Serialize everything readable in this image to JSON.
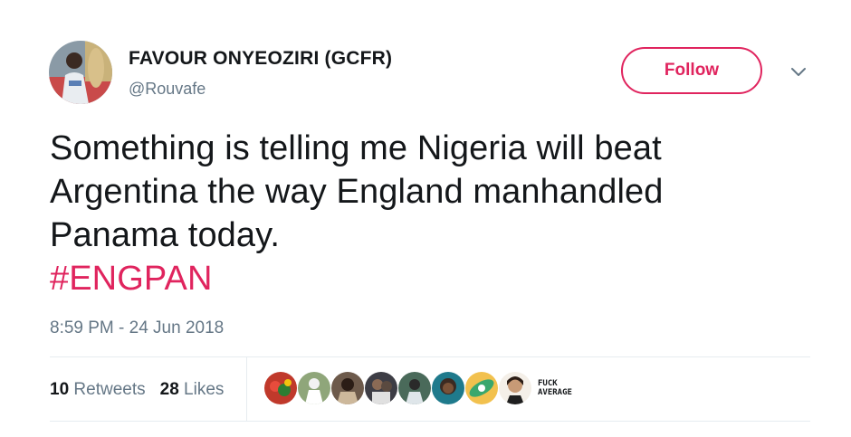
{
  "author": {
    "display_name": "FAVOUR ONYEOZIRI (GCFR)",
    "handle": "@Rouvafe"
  },
  "follow_button": {
    "label": "Follow"
  },
  "tweet": {
    "lines": [
      "Something is telling me Nigeria will beat",
      "Argentina the way England manhandled",
      "Panama today."
    ],
    "hashtag": "#ENGPAN",
    "timestamp": "8:59 PM - 24 Jun 2018"
  },
  "stats": {
    "retweets_count": "10",
    "retweets_label": "Retweets",
    "likes_count": "28",
    "likes_label": "Likes"
  },
  "likers": {
    "last_liker_text_1": "FUCK",
    "last_liker_text_2": "AVERAGE"
  },
  "colors": {
    "accent": "#e0245e",
    "text": "#14171a",
    "secondary": "#657786",
    "divider": "#e6ecf0"
  },
  "icons": [
    "chevron-down-icon"
  ]
}
